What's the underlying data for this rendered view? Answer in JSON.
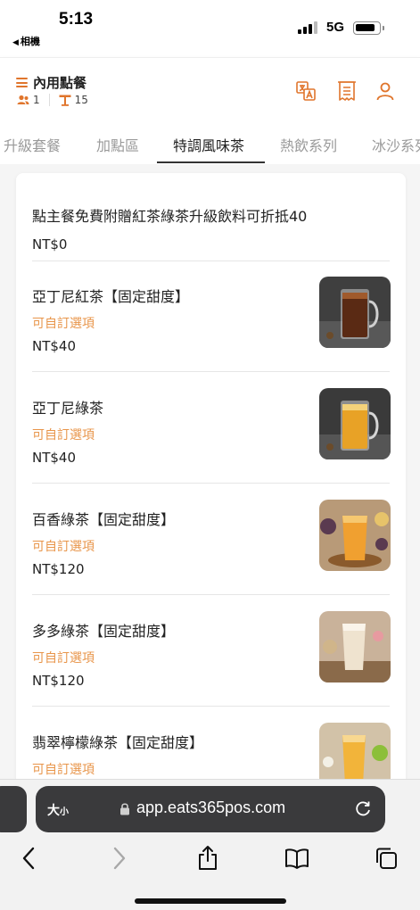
{
  "status_bar": {
    "time": "5:13",
    "back_label": "相機",
    "network": "5G"
  },
  "header": {
    "title": "內用點餐",
    "guests": "1",
    "table": "15",
    "accent_color": "#e0752c"
  },
  "tabs": [
    {
      "label": "升級套餐",
      "active": false
    },
    {
      "label": "加點區",
      "active": false
    },
    {
      "label": "特調風味茶",
      "active": true
    },
    {
      "label": "熱飲系列",
      "active": false
    },
    {
      "label": "冰沙系列",
      "active": false
    }
  ],
  "promo": {
    "title": "點主餐免費附贈紅茶綠茶升級飲料可折抵40",
    "price": "NT$0"
  },
  "items": [
    {
      "name": "亞丁尼紅茶【固定甜度】",
      "option": "可自訂選項",
      "price": "NT$40",
      "image": "black-tea-mug-photo"
    },
    {
      "name": "亞丁尼綠茶",
      "option": "可自訂選項",
      "price": "NT$40",
      "image": "green-tea-mug-photo"
    },
    {
      "name": "百香綠茶【固定甜度】",
      "option": "可自訂選項",
      "price": "NT$120",
      "image": "passionfruit-tea-photo"
    },
    {
      "name": "多多綠茶【固定甜度】",
      "option": "可自訂選項",
      "price": "NT$120",
      "image": "yakult-tea-photo"
    },
    {
      "name": "翡翠檸檬綠茶【固定甜度】",
      "option": "可自訂選項",
      "price": "",
      "image": "lemon-tea-photo"
    }
  ],
  "browser": {
    "text_size_label": "大",
    "text_size_small": "小",
    "url": "app.eats365pos.com"
  }
}
